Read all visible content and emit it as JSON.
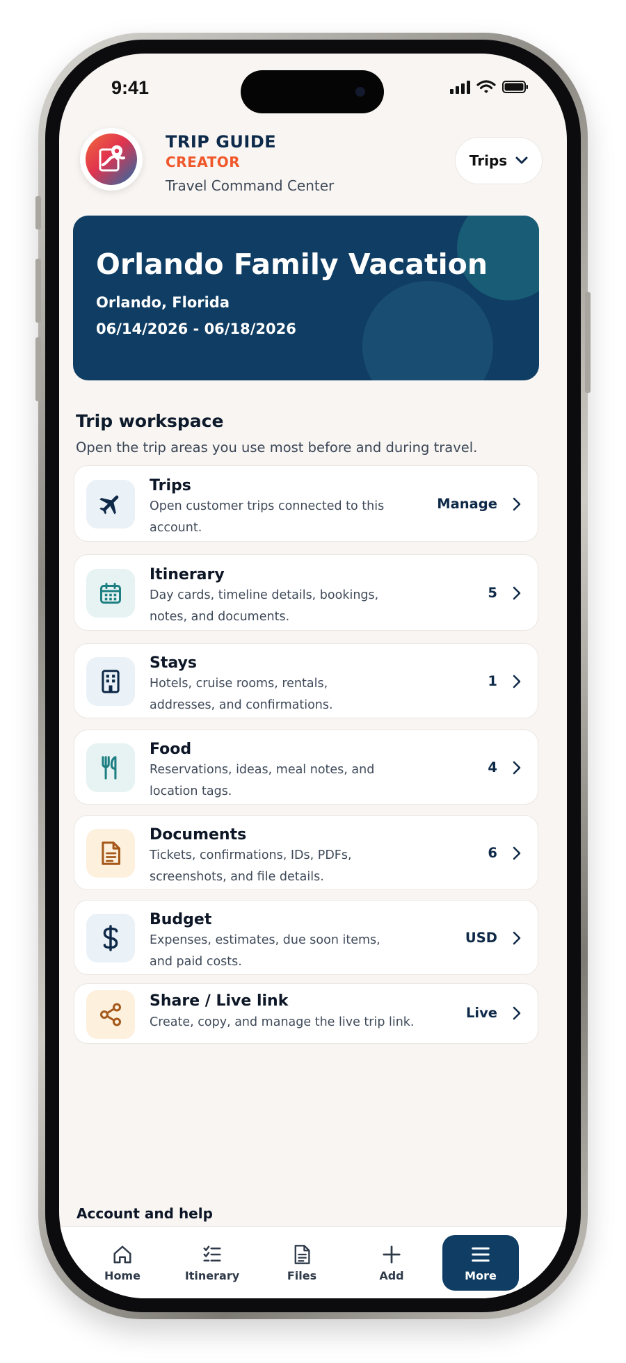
{
  "status_bar": {
    "time": "9:41"
  },
  "header": {
    "brand_title": "TRIP GUIDE",
    "brand_subtitle": "CREATOR",
    "tagline": "Travel Command Center",
    "trips_select_label": "Trips"
  },
  "hero": {
    "title": "Orlando Family Vacation",
    "location": "Orlando, Florida",
    "dates": "06/14/2026 - 06/18/2026"
  },
  "workspace": {
    "title": "Trip workspace",
    "description": "Open the trip areas you use most before and during travel.",
    "cards": [
      {
        "title": "Trips",
        "description": "Open customer trips connected to this account.",
        "value": "Manage",
        "icon": "airplane-icon"
      },
      {
        "title": "Itinerary",
        "description": "Day cards, timeline details, bookings, notes, and documents.",
        "value": "5",
        "icon": "calendar-icon"
      },
      {
        "title": "Stays",
        "description": "Hotels, cruise rooms, rentals, addresses, and confirmations.",
        "value": "1",
        "icon": "building-icon"
      },
      {
        "title": "Food",
        "description": "Reservations, ideas, meal notes, and location tags.",
        "value": "4",
        "icon": "utensils-icon"
      },
      {
        "title": "Documents",
        "description": "Tickets, confirmations, IDs, PDFs, screenshots, and file details.",
        "value": "6",
        "icon": "document-icon"
      },
      {
        "title": "Budget",
        "description": "Expenses, estimates, due soon items, and paid costs.",
        "value": "USD",
        "icon": "dollar-icon"
      },
      {
        "title": "Share / Live link",
        "description": "Create, copy, and manage the live trip link.",
        "value": "Live",
        "icon": "share-icon"
      }
    ]
  },
  "help": {
    "title": "Account and help"
  },
  "bottom_nav": {
    "items": [
      {
        "label": "Home",
        "icon": "home-icon"
      },
      {
        "label": "Itinerary",
        "icon": "checklist-icon"
      },
      {
        "label": "Files",
        "icon": "file-icon"
      },
      {
        "label": "Add",
        "icon": "plus-icon"
      },
      {
        "label": "More",
        "icon": "menu-icon",
        "active": true
      }
    ]
  },
  "colors": {
    "navy": "#0f3d63",
    "accent_orange": "#f0582b",
    "screen_bg": "#f8f5f2",
    "icon_bg_blue": "#eaf1f7",
    "icon_bg_teal": "#e6f3f2",
    "icon_bg_amber": "#fdf0dc"
  }
}
